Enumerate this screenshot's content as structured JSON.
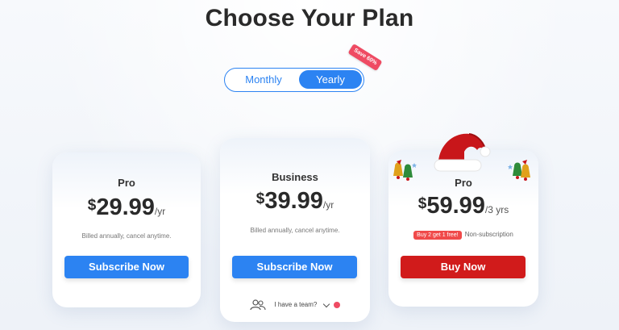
{
  "header": {
    "title": "Choose Your Plan"
  },
  "billing_toggle": {
    "options": [
      "Monthly",
      "Yearly"
    ],
    "selected": "Yearly",
    "badge": "Save 60%"
  },
  "plans": [
    {
      "name": "Pro",
      "currency": "$",
      "amount": "29.99",
      "period": "/yr",
      "note": "Billed annually, cancel anytime.",
      "cta": "Subscribe Now"
    },
    {
      "name": "Business",
      "currency": "$",
      "amount": "39.99",
      "period": "/yr",
      "note": "Billed annually, cancel anytime.",
      "cta": "Subscribe Now",
      "team_link": "I have a team?"
    },
    {
      "name": "Pro",
      "currency": "$",
      "amount": "59.99",
      "period": "/3 yrs",
      "offer_tag": "Buy 2 get 1 free!",
      "offer_note": "Non-subscription",
      "cta": "Buy Now"
    }
  ],
  "colors": {
    "accent_blue": "#2c83f2",
    "buy_red": "#d11b1b",
    "badge_pink": "#ef4b63"
  },
  "decorations": [
    "santa-hat-icon",
    "christmas-bells-icon"
  ]
}
